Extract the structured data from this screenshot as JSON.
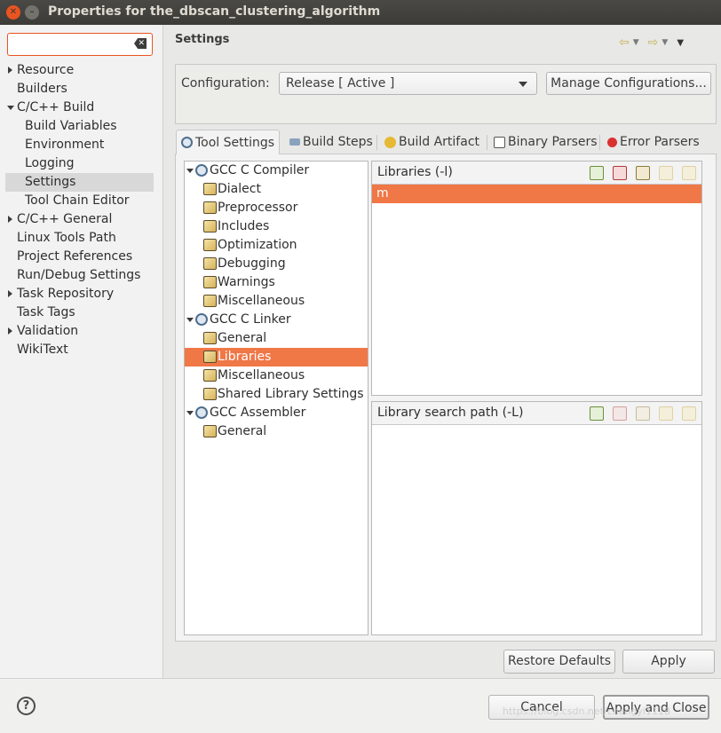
{
  "window": {
    "title": "Properties for the_dbscan_clustering_algorithm",
    "close_glyph": "✕",
    "minimize_glyph": "–"
  },
  "filter": {
    "value": "",
    "placeholder": ""
  },
  "nav": {
    "items": [
      {
        "label": "Resource",
        "level": 0,
        "expander": "collapsed"
      },
      {
        "label": "Builders",
        "level": 0,
        "expander": "none"
      },
      {
        "label": "C/C++ Build",
        "level": 0,
        "expander": "expanded"
      },
      {
        "label": "Build Variables",
        "level": 1,
        "expander": "none"
      },
      {
        "label": "Environment",
        "level": 1,
        "expander": "none"
      },
      {
        "label": "Logging",
        "level": 1,
        "expander": "none"
      },
      {
        "label": "Settings",
        "level": 1,
        "expander": "none",
        "selected": true
      },
      {
        "label": "Tool Chain Editor",
        "level": 1,
        "expander": "none"
      },
      {
        "label": "C/C++ General",
        "level": 0,
        "expander": "collapsed"
      },
      {
        "label": "Linux Tools Path",
        "level": 0,
        "expander": "none"
      },
      {
        "label": "Project References",
        "level": 0,
        "expander": "none"
      },
      {
        "label": "Run/Debug Settings",
        "level": 0,
        "expander": "none"
      },
      {
        "label": "Task Repository",
        "level": 0,
        "expander": "collapsed"
      },
      {
        "label": "Task Tags",
        "level": 0,
        "expander": "none"
      },
      {
        "label": "Validation",
        "level": 0,
        "expander": "collapsed"
      },
      {
        "label": "WikiText",
        "level": 0,
        "expander": "none"
      }
    ]
  },
  "page": {
    "title": "Settings"
  },
  "configuration": {
    "label": "Configuration:",
    "selected": "Release  [ Active ]",
    "manage_label": "Manage Configurations..."
  },
  "tabs": [
    {
      "label": "Tool Settings",
      "icon": "tool-settings-icon",
      "active": true
    },
    {
      "label": "Build Steps",
      "icon": "build-steps-icon"
    },
    {
      "label": "Build Artifact",
      "icon": "trophy-icon"
    },
    {
      "label": "Binary Parsers",
      "icon": "binary-icon"
    },
    {
      "label": "Error Parsers",
      "icon": "error-icon"
    }
  ],
  "tool_tree": [
    {
      "label": "GCC C Compiler",
      "level": 0
    },
    {
      "label": "Dialect",
      "level": 1
    },
    {
      "label": "Preprocessor",
      "level": 1
    },
    {
      "label": "Includes",
      "level": 1
    },
    {
      "label": "Optimization",
      "level": 1
    },
    {
      "label": "Debugging",
      "level": 1
    },
    {
      "label": "Warnings",
      "level": 1
    },
    {
      "label": "Miscellaneous",
      "level": 1
    },
    {
      "label": "GCC C Linker",
      "level": 0
    },
    {
      "label": "General",
      "level": 1
    },
    {
      "label": "Libraries",
      "level": 1,
      "selected": true
    },
    {
      "label": "Miscellaneous",
      "level": 1
    },
    {
      "label": "Shared Library Settings",
      "level": 1
    },
    {
      "label": "GCC Assembler",
      "level": 0
    },
    {
      "label": "General",
      "level": 1
    }
  ],
  "libraries": {
    "title": "Libraries (-l)",
    "items": [
      "m"
    ]
  },
  "search_path": {
    "title": "Library search path (-L)",
    "items": []
  },
  "buttons": {
    "restore_defaults": "Restore Defaults",
    "apply": "Apply",
    "cancel": "Cancel",
    "apply_and_close": "Apply and Close",
    "help": "?"
  },
  "watermark": "https://blog.csdn.net/chengyi1118",
  "colors": {
    "selection": "#f07746",
    "accent": "#e95420"
  }
}
